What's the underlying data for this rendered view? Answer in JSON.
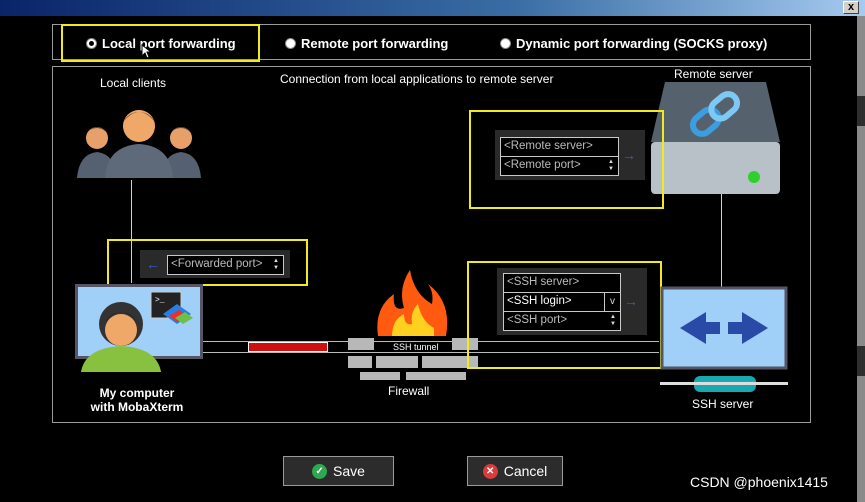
{
  "window": {
    "close_glyph": "x"
  },
  "modes": {
    "local": "Local port forwarding",
    "remote": "Remote port forwarding",
    "dynamic": "Dynamic port forwarding (SOCKS proxy)"
  },
  "diagram": {
    "description": "Connection from local applications to remote server",
    "local_clients": "Local clients",
    "remote_server": "Remote server",
    "my_computer_line1": "My computer",
    "my_computer_line2": "with MobaXterm",
    "firewall": "Firewall",
    "ssh_tunnel": "SSH tunnel",
    "ssh_server": "SSH server"
  },
  "fields": {
    "forwarded_port": "<Forwarded port>",
    "remote_server": "<Remote server>",
    "remote_port": "<Remote port>",
    "ssh_server": "<SSH server>",
    "ssh_login": "<SSH login>",
    "ssh_port": "<SSH port>",
    "dropdown_glyph": "v"
  },
  "buttons": {
    "save": "Save",
    "cancel": "Cancel"
  },
  "watermark": "CSDN @phoenix1415",
  "colors": {
    "highlight": "#f0ea1e",
    "accent_arrow": "#3a58d8",
    "tunnel_red": "#d01010",
    "save_green": "#2fa84f",
    "cancel_red": "#d93a3a"
  }
}
